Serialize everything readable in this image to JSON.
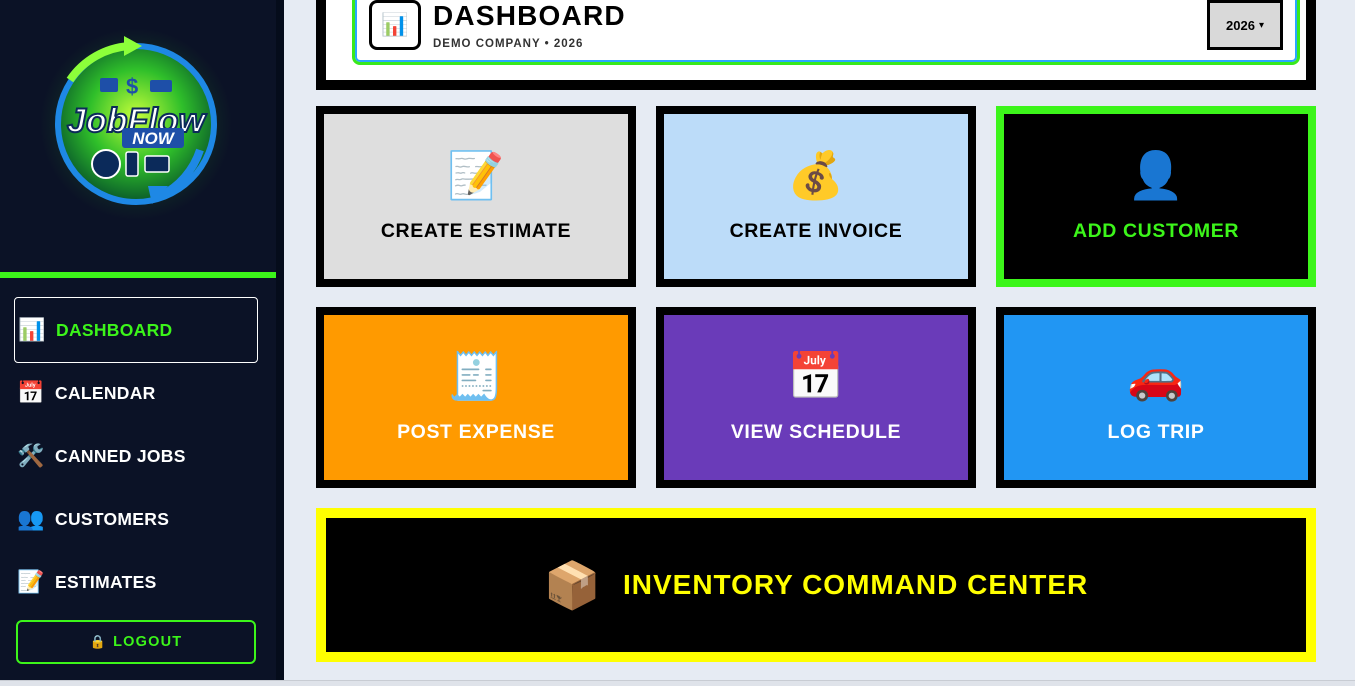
{
  "sidebar": {
    "logo": {
      "line1": "JobFlow",
      "line2": "NOW"
    },
    "items": [
      {
        "icon": "📊",
        "icon_name": "bar-chart-icon",
        "label": "DASHBOARD",
        "active": true
      },
      {
        "icon": "📅",
        "icon_name": "calendar-icon",
        "label": "CALENDAR",
        "active": false
      },
      {
        "icon": "🛠️",
        "icon_name": "tools-icon",
        "label": "CANNED JOBS",
        "active": false
      },
      {
        "icon": "👥",
        "icon_name": "people-icon",
        "label": "CUSTOMERS",
        "active": false
      },
      {
        "icon": "📝",
        "icon_name": "memo-icon",
        "label": "ESTIMATES",
        "active": false
      }
    ],
    "logout": {
      "icon": "🔒",
      "label": "LOGOUT"
    }
  },
  "header": {
    "icon": "📊",
    "title": "DASHBOARD",
    "subtitle": "DEMO COMPANY • 2026",
    "year_selected": "2026"
  },
  "tiles": [
    {
      "icon": "📝",
      "icon_name": "memo-icon",
      "label": "CREATE ESTIMATE",
      "bg": "#dedede",
      "color": "#000000",
      "border": "#000000"
    },
    {
      "icon": "💰",
      "icon_name": "money-bag-icon",
      "label": "CREATE INVOICE",
      "bg": "#bcdcf9",
      "color": "#000000",
      "border": "#000000"
    },
    {
      "icon": "👤",
      "icon_name": "person-icon",
      "label": "ADD CUSTOMER",
      "bg": "#000000",
      "color": "#3cf51a",
      "border": "#3cf51a"
    },
    {
      "icon": "🧾",
      "icon_name": "receipt-icon",
      "label": "POST EXPENSE",
      "bg": "#ff9a00",
      "color": "#ffffff",
      "border": "#000000"
    },
    {
      "icon": "📅",
      "icon_name": "calendar-icon",
      "label": "VIEW SCHEDULE",
      "bg": "#6a3bb9",
      "color": "#ffffff",
      "border": "#000000"
    },
    {
      "icon": "🚗",
      "icon_name": "car-icon",
      "label": "LOG TRIP",
      "bg": "#2196f3",
      "color": "#ffffff",
      "border": "#000000"
    }
  ],
  "inventory": {
    "icon": "📦",
    "label": "INVENTORY COMMAND CENTER"
  },
  "colors": {
    "accent_green": "#3cf51a",
    "sidebar_bg": "#0b1226",
    "inventory_yellow": "#ffff00"
  }
}
